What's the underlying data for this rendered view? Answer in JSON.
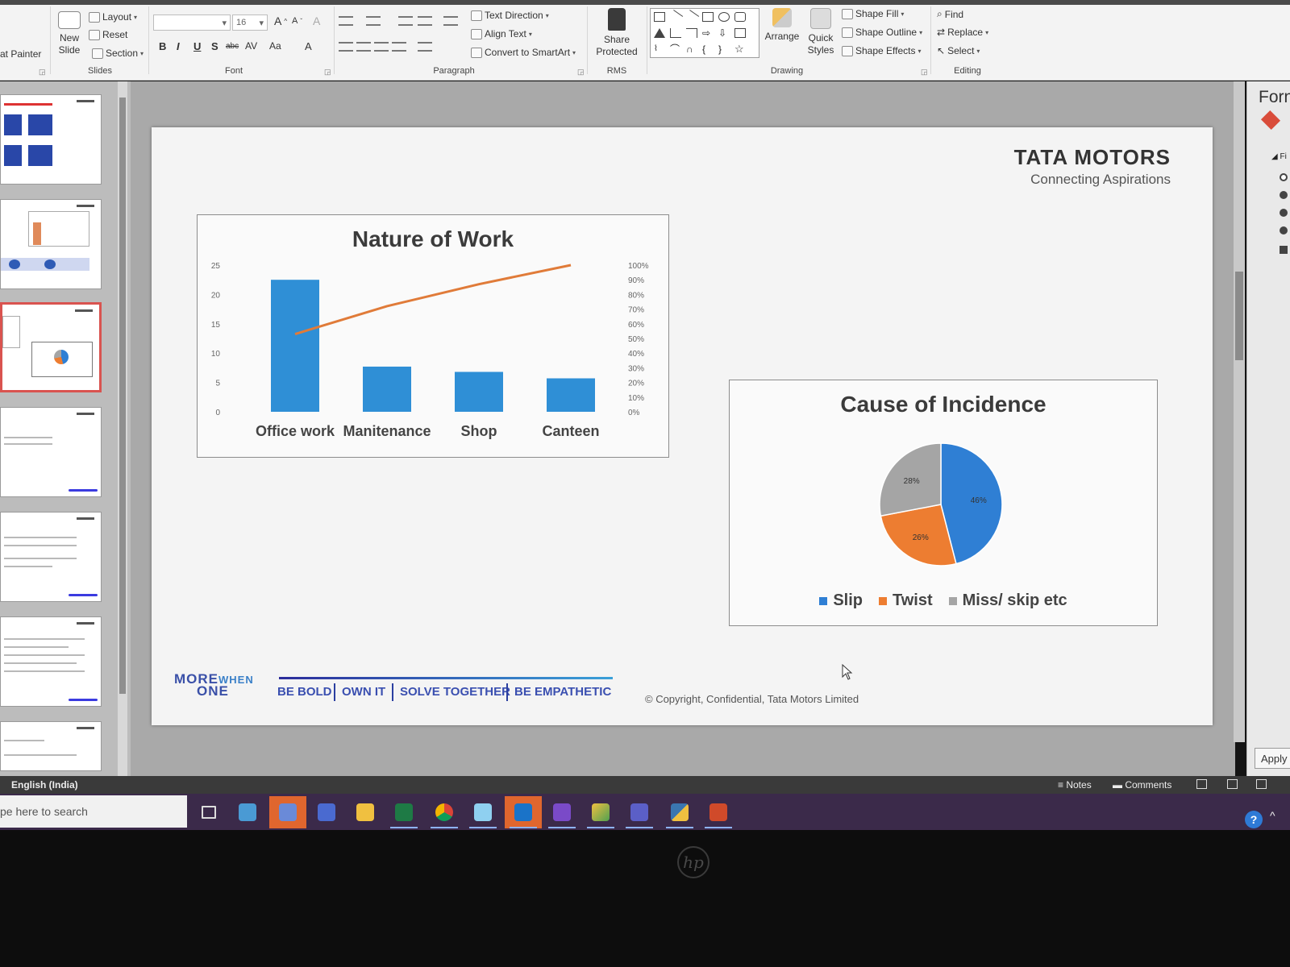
{
  "ribbon": {
    "clipboard": {
      "format_painter": "at Painter"
    },
    "slides": {
      "new_slide": "New\nSlide",
      "layout": "Layout",
      "reset": "Reset",
      "section": "Section",
      "label": "Slides"
    },
    "font": {
      "size": "16",
      "label": "Font",
      "bold": "B",
      "italic": "I",
      "underline": "U",
      "shadow": "S",
      "strike": "abc",
      "spacing": "AV",
      "case": "Aa",
      "color": "A"
    },
    "paragraph": {
      "text_direction": "Text Direction",
      "align_text": "Align Text",
      "convert_smartart": "Convert to SmartArt",
      "label": "Paragraph"
    },
    "rms": {
      "share_protected": "Share\nProtected",
      "label": "RMS"
    },
    "drawing": {
      "arrange": "Arrange",
      "quick_styles": "Quick\nStyles",
      "shape_fill": "Shape Fill",
      "shape_outline": "Shape Outline",
      "shape_effects": "Shape Effects",
      "label": "Drawing"
    },
    "editing": {
      "find": "Find",
      "replace": "Replace",
      "select": "Select",
      "label": "Editing"
    }
  },
  "slide": {
    "brand_name": "TATA MOTORS",
    "brand_tagline": "Connecting Aspirations",
    "footer": {
      "more": "MORE",
      "when": "WHEN",
      "one": "ONE",
      "values": [
        "BE BOLD",
        "OWN IT",
        "SOLVE TOGETHER",
        "BE EMPATHETIC"
      ],
      "copyright": "© Copyright, Confidential, Tata Motors Limited"
    }
  },
  "chart_data": [
    {
      "type": "bar",
      "title": "Nature of Work",
      "categories": [
        "Office work",
        "Manitenance",
        "Shop",
        "Canteen"
      ],
      "series": [
        {
          "values": [
            22.5,
            7.7,
            6.8,
            5.7
          ],
          "color": "#2f8fd6"
        },
        {
          "axis": "secondary",
          "type": "line",
          "values": [
            0.53,
            0.72,
            0.87,
            1.0
          ],
          "color": "#e07b39"
        }
      ],
      "ylim": [
        0,
        25
      ],
      "yticks": [
        "0",
        "5",
        "10",
        "15",
        "20",
        "25"
      ],
      "y2lim": [
        0,
        1
      ],
      "y2ticks": [
        "0%",
        "10%",
        "20%",
        "30%",
        "40%",
        "50%",
        "60%",
        "70%",
        "80%",
        "90%",
        "100%"
      ],
      "grid": false
    },
    {
      "type": "pie",
      "title": "Cause of Incidence",
      "categories": [
        "Slip",
        "Twist",
        "Miss/ skip etc"
      ],
      "values": [
        46,
        26,
        28
      ],
      "data_labels": [
        "46%",
        "26%",
        "28%"
      ],
      "colors": [
        "#2f7fd4",
        "#ed7d31",
        "#a5a5a5"
      ],
      "legend": "bottom"
    }
  ],
  "format_pane": {
    "title": "Forn",
    "apply": "Apply"
  },
  "status_bar": {
    "language": "English (India)",
    "notes": "Notes",
    "comments": "Comments"
  },
  "taskbar": {
    "search_placeholder": "pe here to search"
  }
}
